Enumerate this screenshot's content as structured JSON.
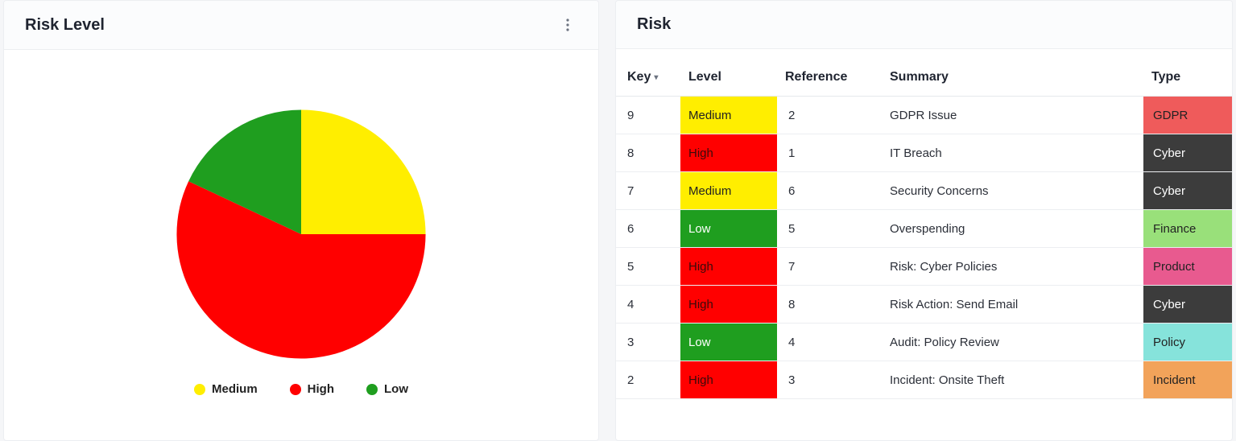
{
  "left_card": {
    "title": "Risk Level",
    "legend": [
      {
        "label": "Medium",
        "color": "#ffee00"
      },
      {
        "label": "High",
        "color": "#ff0000"
      },
      {
        "label": "Low",
        "color": "#1f9e1f"
      }
    ]
  },
  "right_card": {
    "title": "Risk",
    "columns": {
      "key": "Key",
      "level": "Level",
      "reference": "Reference",
      "summary": "Summary",
      "type": "Type"
    },
    "rows": [
      {
        "key": "9",
        "level": "Medium",
        "reference": "2",
        "summary": "GDPR Issue",
        "type": "GDPR",
        "type_color": "#ef5b5b",
        "type_text": "#222"
      },
      {
        "key": "8",
        "level": "High",
        "reference": "1",
        "summary": "IT Breach",
        "type": "Cyber",
        "type_color": "#3c3c3c",
        "type_text": "#fff"
      },
      {
        "key": "7",
        "level": "Medium",
        "reference": "6",
        "summary": "Security Concerns",
        "type": "Cyber",
        "type_color": "#3c3c3c",
        "type_text": "#fff"
      },
      {
        "key": "6",
        "level": "Low",
        "reference": "5",
        "summary": "Overspending",
        "type": "Finance",
        "type_color": "#99e07a",
        "type_text": "#222"
      },
      {
        "key": "5",
        "level": "High",
        "reference": "7",
        "summary": "Risk: Cyber Policies",
        "type": "Product",
        "type_color": "#e85a8f",
        "type_text": "#222"
      },
      {
        "key": "4",
        "level": "High",
        "reference": "8",
        "summary": "Risk Action: Send Email",
        "type": "Cyber",
        "type_color": "#3c3c3c",
        "type_text": "#fff"
      },
      {
        "key": "3",
        "level": "Low",
        "reference": "4",
        "summary": "Audit: Policy Review",
        "type": "Policy",
        "type_color": "#86e3db",
        "type_text": "#222"
      },
      {
        "key": "2",
        "level": "High",
        "reference": "3",
        "summary": "Incident: Onsite Theft",
        "type": "Incident",
        "type_color": "#f2a35a",
        "type_text": "#222"
      }
    ]
  },
  "chart_data": {
    "type": "pie",
    "title": "Risk Level",
    "series": [
      {
        "name": "Medium",
        "value": 25,
        "color": "#ffee00"
      },
      {
        "name": "High",
        "value": 57,
        "color": "#ff0000"
      },
      {
        "name": "Low",
        "value": 18,
        "color": "#1f9e1f"
      }
    ],
    "start_angle_deg": 0,
    "total": 100,
    "legend_position": "bottom"
  }
}
